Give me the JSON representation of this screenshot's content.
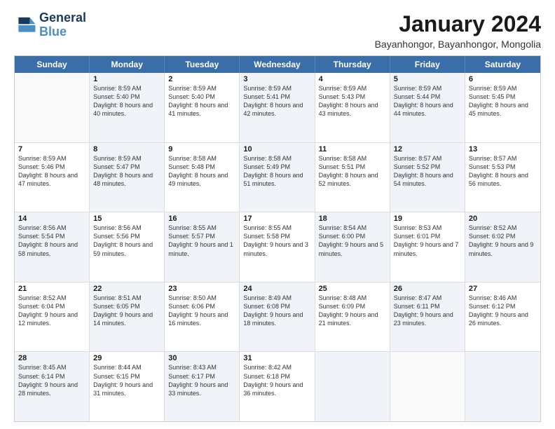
{
  "logo": {
    "line1": "General",
    "line2": "Blue"
  },
  "title": "January 2024",
  "subtitle": "Bayanhongor, Bayanhongor, Mongolia",
  "days": [
    "Sunday",
    "Monday",
    "Tuesday",
    "Wednesday",
    "Thursday",
    "Friday",
    "Saturday"
  ],
  "rows": [
    [
      {
        "day": "",
        "sunrise": "",
        "sunset": "",
        "daylight": "",
        "shaded": false
      },
      {
        "day": "1",
        "sunrise": "Sunrise: 8:59 AM",
        "sunset": "Sunset: 5:40 PM",
        "daylight": "Daylight: 8 hours and 40 minutes.",
        "shaded": true
      },
      {
        "day": "2",
        "sunrise": "Sunrise: 8:59 AM",
        "sunset": "Sunset: 5:40 PM",
        "daylight": "Daylight: 8 hours and 41 minutes.",
        "shaded": false
      },
      {
        "day": "3",
        "sunrise": "Sunrise: 8:59 AM",
        "sunset": "Sunset: 5:41 PM",
        "daylight": "Daylight: 8 hours and 42 minutes.",
        "shaded": true
      },
      {
        "day": "4",
        "sunrise": "Sunrise: 8:59 AM",
        "sunset": "Sunset: 5:43 PM",
        "daylight": "Daylight: 8 hours and 43 minutes.",
        "shaded": false
      },
      {
        "day": "5",
        "sunrise": "Sunrise: 8:59 AM",
        "sunset": "Sunset: 5:44 PM",
        "daylight": "Daylight: 8 hours and 44 minutes.",
        "shaded": true
      },
      {
        "day": "6",
        "sunrise": "Sunrise: 8:59 AM",
        "sunset": "Sunset: 5:45 PM",
        "daylight": "Daylight: 8 hours and 45 minutes.",
        "shaded": false
      }
    ],
    [
      {
        "day": "7",
        "sunrise": "Sunrise: 8:59 AM",
        "sunset": "Sunset: 5:46 PM",
        "daylight": "Daylight: 8 hours and 47 minutes.",
        "shaded": false
      },
      {
        "day": "8",
        "sunrise": "Sunrise: 8:59 AM",
        "sunset": "Sunset: 5:47 PM",
        "daylight": "Daylight: 8 hours and 48 minutes.",
        "shaded": true
      },
      {
        "day": "9",
        "sunrise": "Sunrise: 8:58 AM",
        "sunset": "Sunset: 5:48 PM",
        "daylight": "Daylight: 8 hours and 49 minutes.",
        "shaded": false
      },
      {
        "day": "10",
        "sunrise": "Sunrise: 8:58 AM",
        "sunset": "Sunset: 5:49 PM",
        "daylight": "Daylight: 8 hours and 51 minutes.",
        "shaded": true
      },
      {
        "day": "11",
        "sunrise": "Sunrise: 8:58 AM",
        "sunset": "Sunset: 5:51 PM",
        "daylight": "Daylight: 8 hours and 52 minutes.",
        "shaded": false
      },
      {
        "day": "12",
        "sunrise": "Sunrise: 8:57 AM",
        "sunset": "Sunset: 5:52 PM",
        "daylight": "Daylight: 8 hours and 54 minutes.",
        "shaded": true
      },
      {
        "day": "13",
        "sunrise": "Sunrise: 8:57 AM",
        "sunset": "Sunset: 5:53 PM",
        "daylight": "Daylight: 8 hours and 56 minutes.",
        "shaded": false
      }
    ],
    [
      {
        "day": "14",
        "sunrise": "Sunrise: 8:56 AM",
        "sunset": "Sunset: 5:54 PM",
        "daylight": "Daylight: 8 hours and 58 minutes.",
        "shaded": true
      },
      {
        "day": "15",
        "sunrise": "Sunrise: 8:56 AM",
        "sunset": "Sunset: 5:56 PM",
        "daylight": "Daylight: 8 hours and 59 minutes.",
        "shaded": false
      },
      {
        "day": "16",
        "sunrise": "Sunrise: 8:55 AM",
        "sunset": "Sunset: 5:57 PM",
        "daylight": "Daylight: 9 hours and 1 minute.",
        "shaded": true
      },
      {
        "day": "17",
        "sunrise": "Sunrise: 8:55 AM",
        "sunset": "Sunset: 5:58 PM",
        "daylight": "Daylight: 9 hours and 3 minutes.",
        "shaded": false
      },
      {
        "day": "18",
        "sunrise": "Sunrise: 8:54 AM",
        "sunset": "Sunset: 6:00 PM",
        "daylight": "Daylight: 9 hours and 5 minutes.",
        "shaded": true
      },
      {
        "day": "19",
        "sunrise": "Sunrise: 8:53 AM",
        "sunset": "Sunset: 6:01 PM",
        "daylight": "Daylight: 9 hours and 7 minutes.",
        "shaded": false
      },
      {
        "day": "20",
        "sunrise": "Sunrise: 8:52 AM",
        "sunset": "Sunset: 6:02 PM",
        "daylight": "Daylight: 9 hours and 9 minutes.",
        "shaded": true
      }
    ],
    [
      {
        "day": "21",
        "sunrise": "Sunrise: 8:52 AM",
        "sunset": "Sunset: 6:04 PM",
        "daylight": "Daylight: 9 hours and 12 minutes.",
        "shaded": false
      },
      {
        "day": "22",
        "sunrise": "Sunrise: 8:51 AM",
        "sunset": "Sunset: 6:05 PM",
        "daylight": "Daylight: 9 hours and 14 minutes.",
        "shaded": true
      },
      {
        "day": "23",
        "sunrise": "Sunrise: 8:50 AM",
        "sunset": "Sunset: 6:06 PM",
        "daylight": "Daylight: 9 hours and 16 minutes.",
        "shaded": false
      },
      {
        "day": "24",
        "sunrise": "Sunrise: 8:49 AM",
        "sunset": "Sunset: 6:08 PM",
        "daylight": "Daylight: 9 hours and 18 minutes.",
        "shaded": true
      },
      {
        "day": "25",
        "sunrise": "Sunrise: 8:48 AM",
        "sunset": "Sunset: 6:09 PM",
        "daylight": "Daylight: 9 hours and 21 minutes.",
        "shaded": false
      },
      {
        "day": "26",
        "sunrise": "Sunrise: 8:47 AM",
        "sunset": "Sunset: 6:11 PM",
        "daylight": "Daylight: 9 hours and 23 minutes.",
        "shaded": true
      },
      {
        "day": "27",
        "sunrise": "Sunrise: 8:46 AM",
        "sunset": "Sunset: 6:12 PM",
        "daylight": "Daylight: 9 hours and 26 minutes.",
        "shaded": false
      }
    ],
    [
      {
        "day": "28",
        "sunrise": "Sunrise: 8:45 AM",
        "sunset": "Sunset: 6:14 PM",
        "daylight": "Daylight: 9 hours and 28 minutes.",
        "shaded": true
      },
      {
        "day": "29",
        "sunrise": "Sunrise: 8:44 AM",
        "sunset": "Sunset: 6:15 PM",
        "daylight": "Daylight: 9 hours and 31 minutes.",
        "shaded": false
      },
      {
        "day": "30",
        "sunrise": "Sunrise: 8:43 AM",
        "sunset": "Sunset: 6:17 PM",
        "daylight": "Daylight: 9 hours and 33 minutes.",
        "shaded": true
      },
      {
        "day": "31",
        "sunrise": "Sunrise: 8:42 AM",
        "sunset": "Sunset: 6:18 PM",
        "daylight": "Daylight: 9 hours and 36 minutes.",
        "shaded": false
      },
      {
        "day": "",
        "sunrise": "",
        "sunset": "",
        "daylight": "",
        "shaded": true
      },
      {
        "day": "",
        "sunrise": "",
        "sunset": "",
        "daylight": "",
        "shaded": false
      },
      {
        "day": "",
        "sunrise": "",
        "sunset": "",
        "daylight": "",
        "shaded": true
      }
    ]
  ]
}
